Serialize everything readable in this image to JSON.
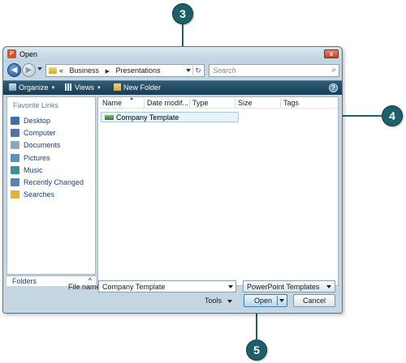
{
  "callouts": {
    "c3": "3",
    "c4": "4",
    "c5": "5"
  },
  "window": {
    "title": "Open",
    "close_glyph": "x"
  },
  "address": {
    "overflow": "«",
    "segments": [
      "Business",
      "Presentations"
    ],
    "separator": "▶",
    "refresh_glyph": "↻"
  },
  "search": {
    "placeholder": "Search",
    "icon_glyph": "⌕"
  },
  "toolbar": {
    "organize": "Organize",
    "views": "Views",
    "new_folder": "New Folder",
    "help_glyph": "?"
  },
  "sidebar": {
    "heading": "Favorite Links",
    "items": [
      {
        "label": "Desktop",
        "icon": "desktop-icon",
        "color": "#3a6fb0"
      },
      {
        "label": "Computer",
        "icon": "computer-icon",
        "color": "#4a76a8"
      },
      {
        "label": "Documents",
        "icon": "documents-icon",
        "color": "#8fa7bd"
      },
      {
        "label": "Pictures",
        "icon": "pictures-icon",
        "color": "#5d8fbf"
      },
      {
        "label": "Music",
        "icon": "music-icon",
        "color": "#3f8f9a"
      },
      {
        "label": "Recently Changed",
        "icon": "recent-icon",
        "color": "#5a83b5"
      },
      {
        "label": "Searches",
        "icon": "searches-folder-icon",
        "color": "#e2b33c"
      }
    ],
    "folders_label": "Folders",
    "folders_chevron": "^"
  },
  "columns": [
    "Name",
    "Date modif...",
    "Type",
    "Size",
    "Tags"
  ],
  "files": [
    {
      "name": "Company Template"
    }
  ],
  "form": {
    "file_name_label": "File name:",
    "file_name_value": "Company Template",
    "file_type_value": "PowerPoint Templates",
    "tools_label": "Tools",
    "open_label": "Open",
    "cancel_label": "Cancel"
  },
  "colors": {
    "accent": "#1f5f6b",
    "toolbar": "#2e5c78"
  }
}
